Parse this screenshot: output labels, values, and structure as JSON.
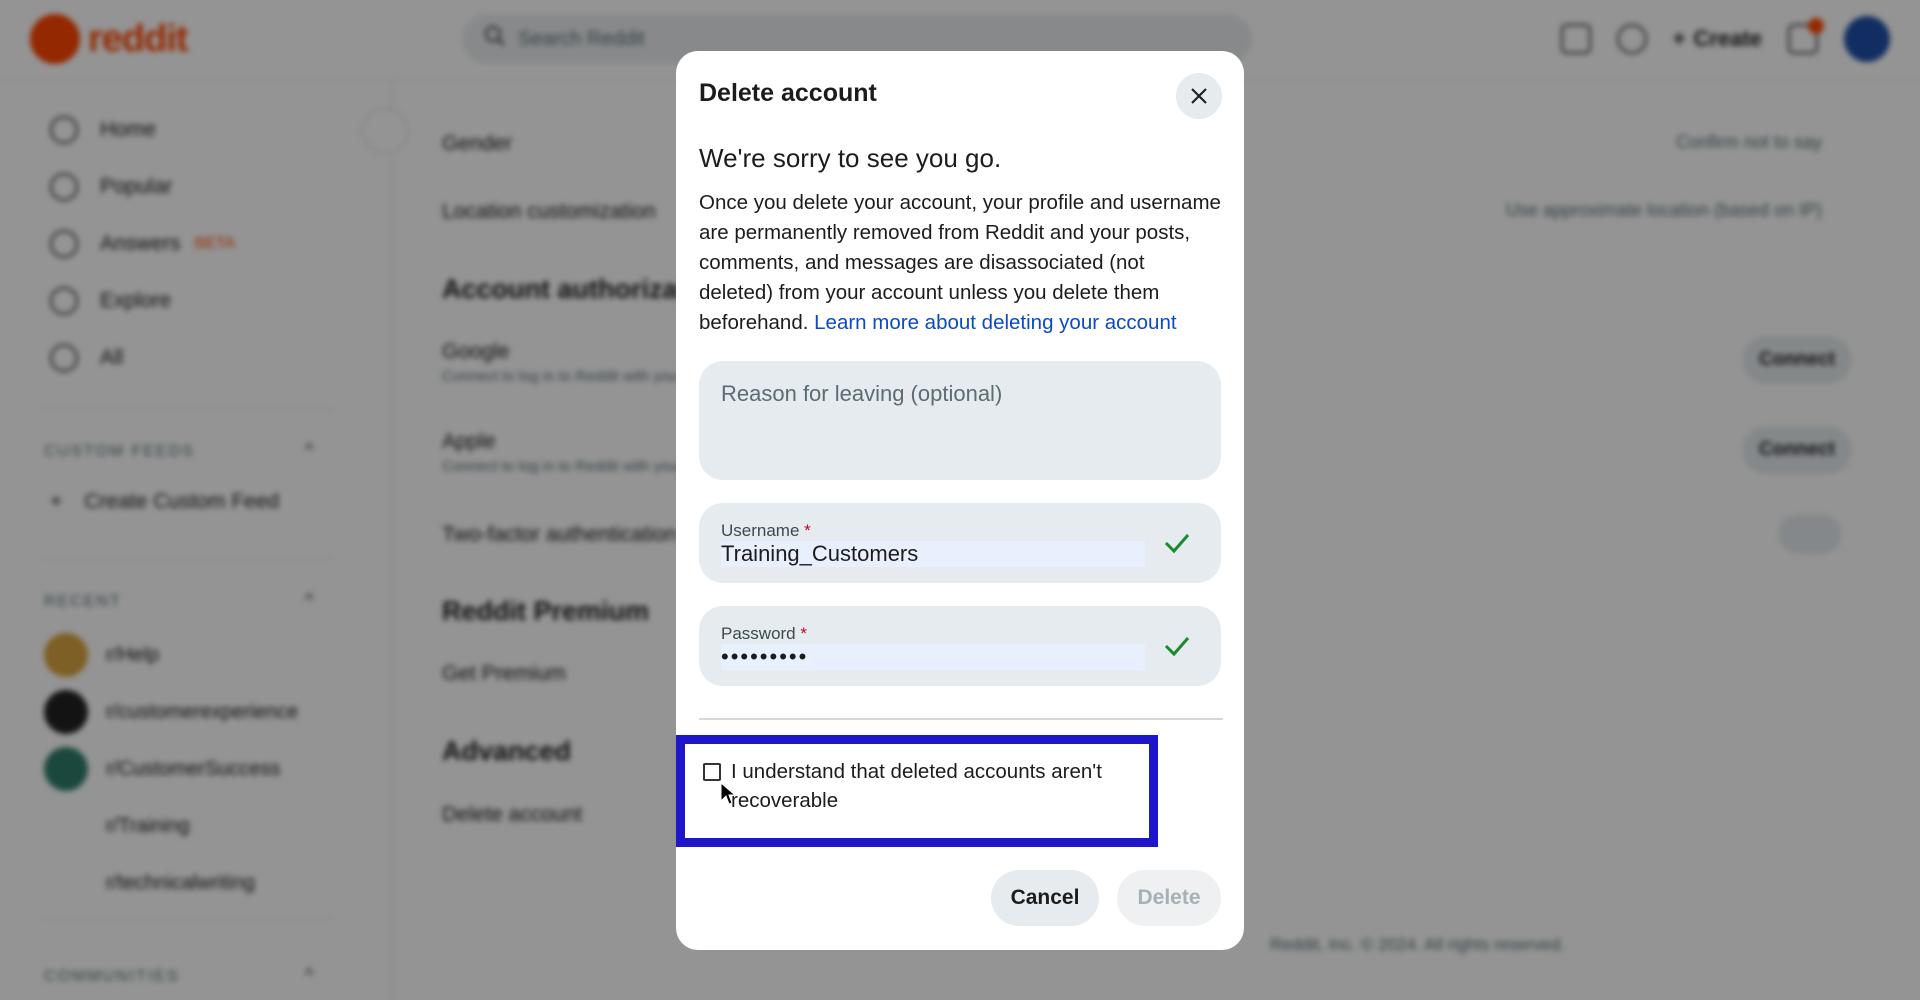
{
  "background": {
    "logo_text": "reddit",
    "search_placeholder": "Search Reddit",
    "create_label": "Create",
    "nav": [
      "Home",
      "Popular",
      "Answers",
      "Explore",
      "All"
    ],
    "answers_badge": "BETA",
    "custom_feeds_heading": "CUSTOM FEEDS",
    "create_custom_feed": "Create Custom Feed",
    "recent_heading": "RECENT",
    "recent_items": [
      "r/Help",
      "r/customerexperience",
      "r/CustomerSuccess",
      "r/Training",
      "r/technicalwriting"
    ],
    "communities_heading": "COMMUNITIES",
    "settings": {
      "gender_label": "Gender",
      "gender_value": "Confirm not to say",
      "location_label": "Location customization",
      "location_value": "Use approximate location (based on IP)",
      "account_auth_heading": "Account authorization",
      "google_label": "Google",
      "google_sub": "Connect to log in to Reddit with your Google account",
      "apple_label": "Apple",
      "apple_sub": "Connect to log in to Reddit with your Apple account",
      "connect_label": "Connect",
      "two_factor_label": "Two-factor authentication",
      "premium_heading": "Reddit Premium",
      "get_premium_label": "Get Premium",
      "advanced_heading": "Advanced",
      "delete_account_label": "Delete account"
    },
    "footer": "Reddit, Inc. © 2024. All rights reserved."
  },
  "modal": {
    "title": "Delete account",
    "subheading": "We're sorry to see you go.",
    "body": "Once you delete your account, your profile and username are permanently removed from Reddit and your posts, comments, and messages are disassociated (not deleted) from your account unless you delete them beforehand.",
    "learn_more": "Learn more about deleting your account",
    "reason_placeholder": "Reason for leaving (optional)",
    "username_label": "Username",
    "username_value": "Training_Customers",
    "password_label": "Password",
    "password_value": "•••••••••",
    "required_mark": "*",
    "confirm_text": "I understand that deleted accounts aren't recoverable",
    "cancel_label": "Cancel",
    "delete_label": "Delete"
  },
  "colors": {
    "brand": "#ff4500",
    "link": "#0a4ac6",
    "valid_check": "#1a8a2e",
    "highlight": "#1d17c9"
  },
  "icons": [
    "close-icon",
    "check-icon",
    "search-icon",
    "mouse-cursor-icon"
  ]
}
